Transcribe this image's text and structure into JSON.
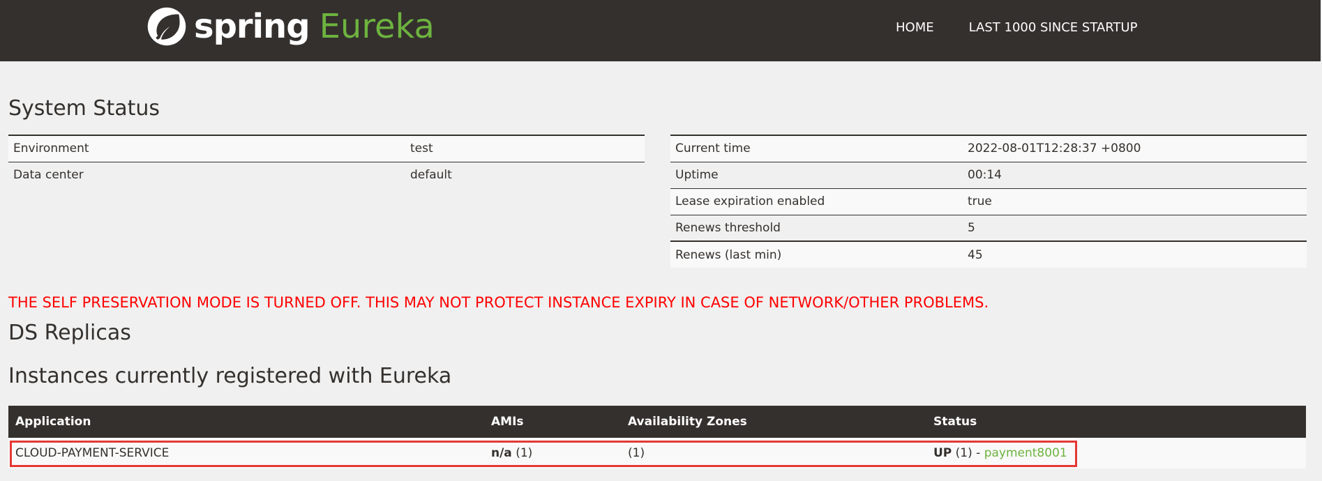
{
  "brand": {
    "spring": "spring",
    "eureka": "Eureka"
  },
  "nav": {
    "home": "HOME",
    "last1000": "LAST 1000 SINCE STARTUP"
  },
  "system_status": {
    "title": "System Status",
    "left_rows": [
      {
        "label": "Environment",
        "value": "test"
      },
      {
        "label": "Data center",
        "value": "default"
      }
    ],
    "right_rows": [
      {
        "label": "Current time",
        "value": "2022-08-01T12:28:37 +0800"
      },
      {
        "label": "Uptime",
        "value": "00:14"
      },
      {
        "label": "Lease expiration enabled",
        "value": "true"
      },
      {
        "label": "Renews threshold",
        "value": "5"
      },
      {
        "label": "Renews (last min)",
        "value": "45"
      }
    ]
  },
  "warning": "THE SELF PRESERVATION MODE IS TURNED OFF. THIS MAY NOT PROTECT INSTANCE EXPIRY IN CASE OF NETWORK/OTHER PROBLEMS.",
  "ds_replicas": {
    "title": "DS Replicas"
  },
  "instances": {
    "title": "Instances currently registered with Eureka",
    "headers": [
      "Application",
      "AMIs",
      "Availability Zones",
      "Status"
    ],
    "rows": [
      {
        "application": "CLOUD-PAYMENT-SERVICE",
        "amis_bold": "n/a",
        "amis_count": " (1)",
        "zones": "(1)",
        "status_bold": "UP",
        "status_count": " (1) - ",
        "instance_link": "payment8001"
      }
    ]
  },
  "colors": {
    "navbar": "#34302d",
    "accent_green": "#6db33f",
    "warning_red": "#ff0000",
    "highlight_red": "#e53935"
  }
}
